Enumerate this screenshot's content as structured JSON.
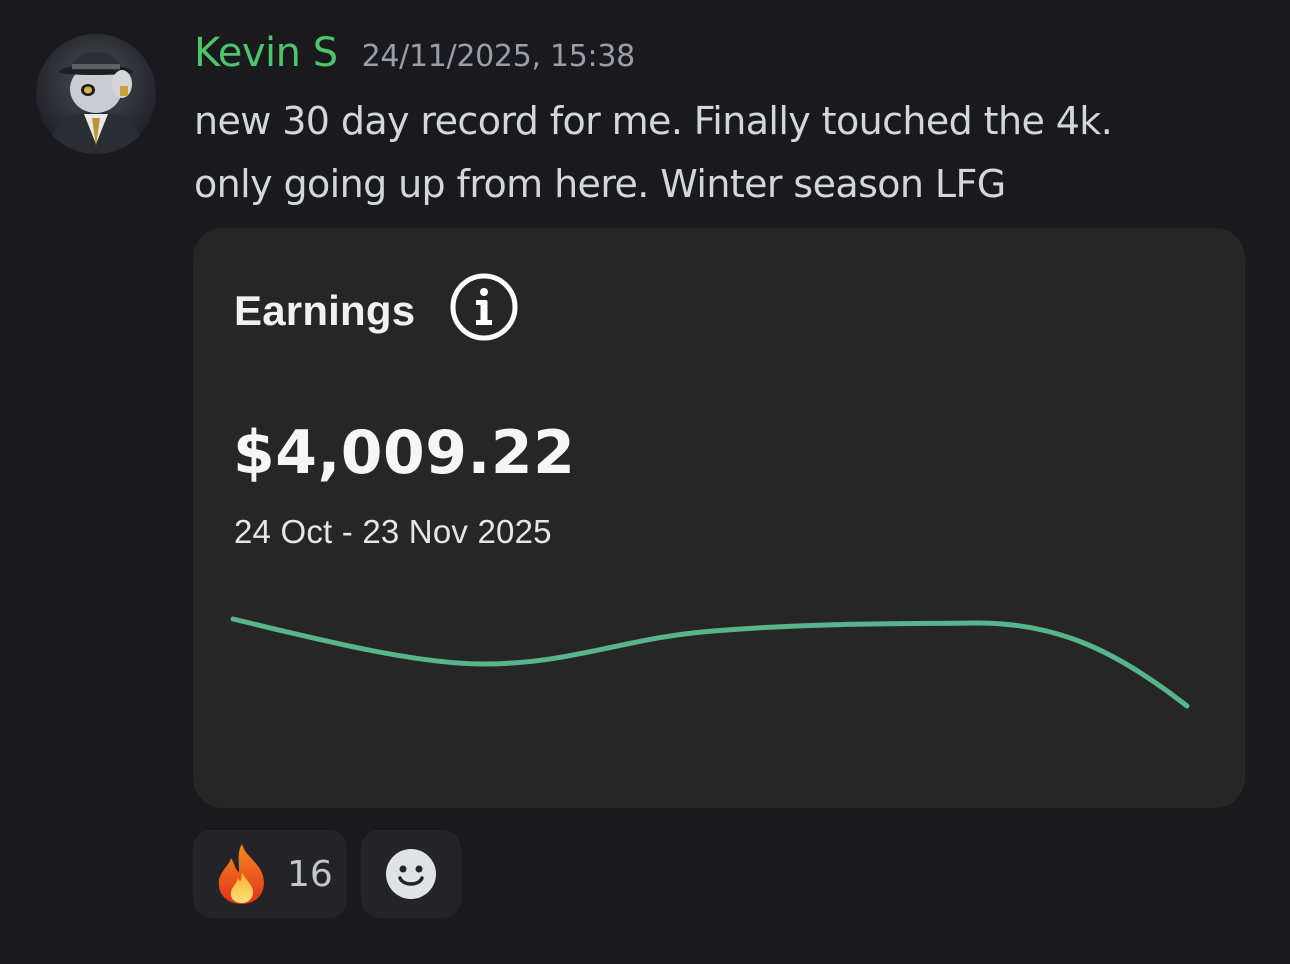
{
  "message": {
    "author": "Kevin S",
    "timestamp": "24/11/2025, 15:38",
    "content_lines": [
      "new 30 day record for me. Finally touched the 4k.",
      "only going up from here. Winter season LFG"
    ]
  },
  "embed": {
    "title": "Earnings",
    "amount": "$4,009.22",
    "date_range": "24 Oct - 23 Nov 2025",
    "line_color": "#58b48a"
  },
  "reactions": [
    {
      "emoji": "fire-icon",
      "count": "16"
    }
  ],
  "colors": {
    "background": "#1a1a1e",
    "username": "#4ec46b",
    "embed_bg": "#262627",
    "reaction_bg": "#242428"
  }
}
